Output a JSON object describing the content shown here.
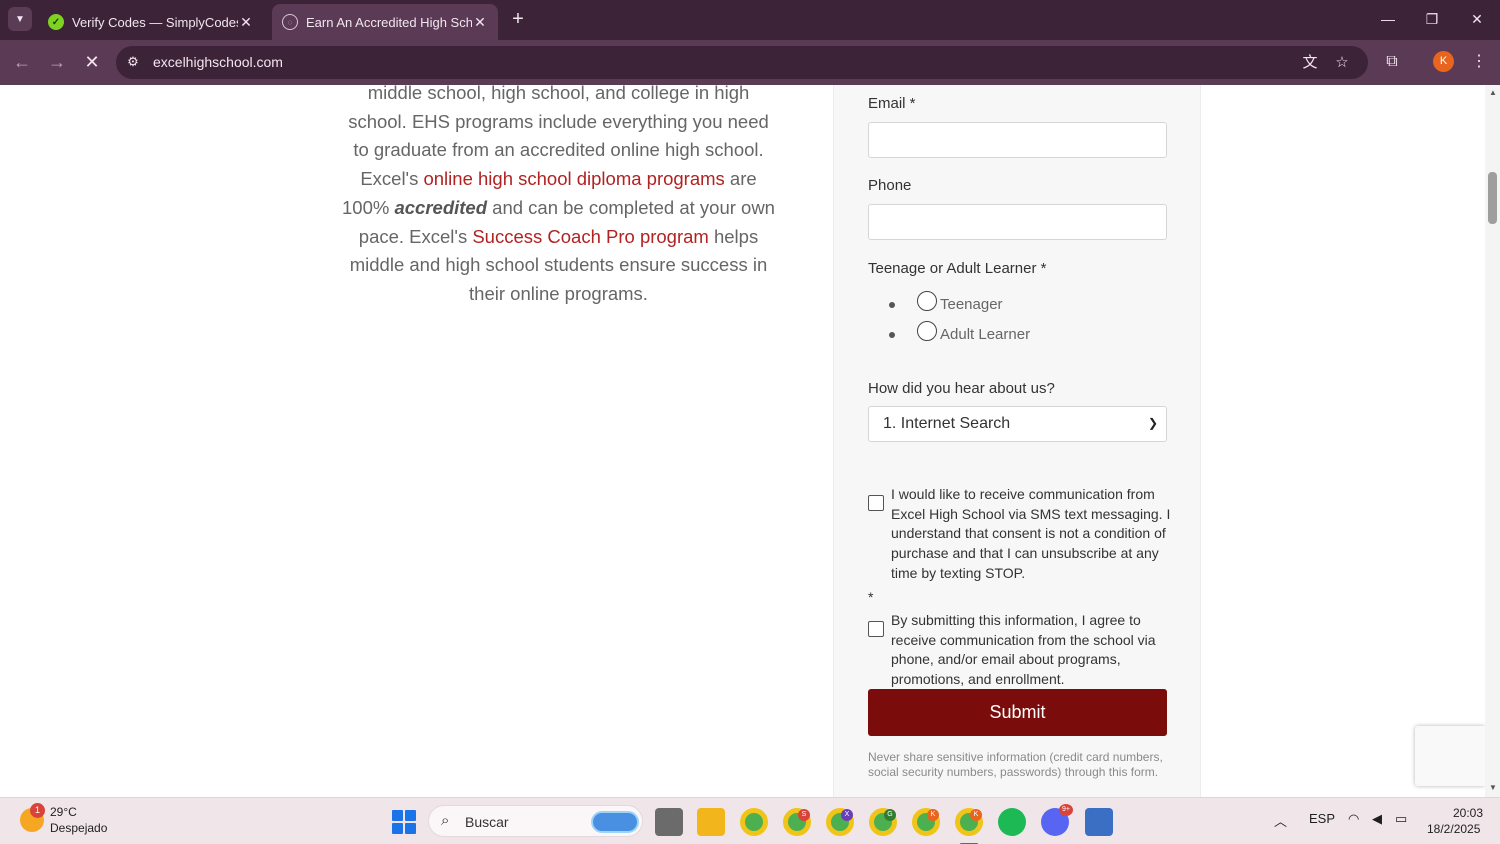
{
  "browser": {
    "tabs": [
      {
        "title": "Verify Codes — SimplyCodes",
        "active": false
      },
      {
        "title": "Earn An Accredited High School",
        "active": true
      }
    ],
    "url": "excelhighschool.com",
    "profile_initial": "K"
  },
  "page": {
    "intro": {
      "line1": "middle school, high school, and college in high school. EHS programs include everything you need to graduate from an accredited online high school. Excel's ",
      "link1": "online high school diploma programs",
      "line2": " are 100% ",
      "bold": "accredited",
      "line3": " and can be completed at your own pace. Excel's ",
      "link2": "Success Coach Pro program",
      "line4": " helps middle and high school students ensure success in their online programs."
    },
    "form": {
      "email_label": "Email *",
      "email_value": "",
      "phone_label": "Phone",
      "phone_value": "",
      "learner_label": "Teenage or Adult Learner *",
      "learner_options": [
        "Teenager",
        "Adult Learner"
      ],
      "hear_label": "How did you hear about us?",
      "hear_selected": "1. Internet Search",
      "sms_consent": "I would like to receive communication from Excel High School via SMS text messaging. I understand that consent is not a condition of purchase and that I can unsubscribe at any time by texting STOP.",
      "required_mark": "*",
      "agree_consent": "By submitting this information, I agree to receive communication from the school via phone, and/or email about programs, promotions, and enrollment.",
      "submit_label": "Submit",
      "disclaimer": "Never share sensitive information (credit card numbers, social security numbers, passwords) through this form."
    }
  },
  "taskbar": {
    "weather_temp": "29°C",
    "weather_desc": "Despejado",
    "weather_badge": "1",
    "search_placeholder": "Buscar",
    "language": "ESP",
    "time": "20:03",
    "date": "18/2/2025",
    "apps": [
      {
        "name": "task-view",
        "color": "#6b6b6b"
      },
      {
        "name": "file-explorer",
        "color": "#f2b61c"
      },
      {
        "name": "chrome",
        "color": "#4caf50"
      },
      {
        "name": "chrome-profile-s",
        "color": "#4caf50",
        "badge": "S",
        "badge_color": "#d9433a"
      },
      {
        "name": "chrome-profile-x",
        "color": "#4caf50",
        "badge": "X",
        "badge_color": "#6a3fb5"
      },
      {
        "name": "chrome-profile-g",
        "color": "#4caf50",
        "badge": "G",
        "badge_color": "#2e7d32"
      },
      {
        "name": "chrome-profile-k1",
        "color": "#4caf50",
        "badge": "K",
        "badge_color": "#e8651f"
      },
      {
        "name": "chrome-profile-k2",
        "color": "#4caf50",
        "badge": "K",
        "badge_color": "#e8651f"
      },
      {
        "name": "spotify",
        "color": "#1db954"
      },
      {
        "name": "discord",
        "color": "#5865f2",
        "badge": "9+",
        "badge_color": "#d9433a"
      },
      {
        "name": "calculator",
        "color": "#3b6fc4"
      }
    ]
  }
}
